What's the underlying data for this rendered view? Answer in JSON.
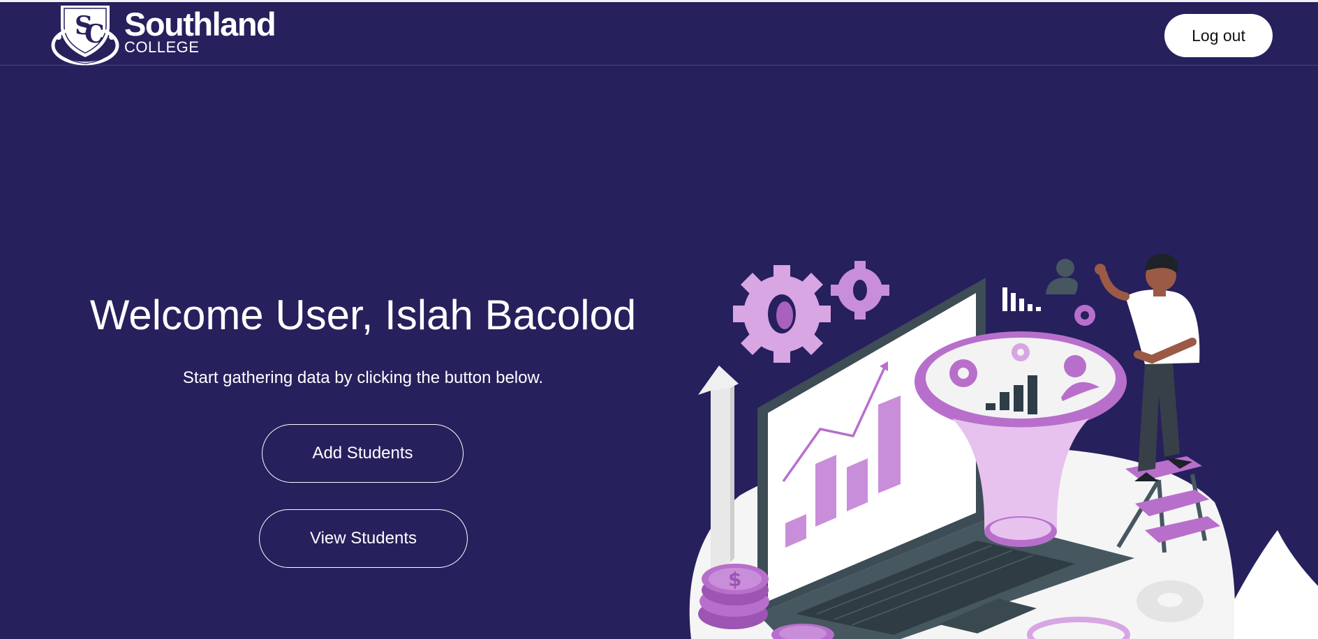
{
  "header": {
    "brand_name": "Southland",
    "brand_sub": "COLLEGE",
    "logout_label": "Log out"
  },
  "main": {
    "welcome": "Welcome User, Islah Bacolod",
    "subtitle": "Start gathering data by clicking the button below.",
    "add_students_label": "Add Students",
    "view_students_label": "View Students"
  },
  "colors": {
    "background": "#26205d",
    "accent_purple": "#b86fcc",
    "light_purple": "#e2b6ea",
    "laptop_gray": "#465760"
  },
  "icons": [
    "college-seal-logo",
    "gear-icon",
    "person-icon",
    "bar-chart-icon",
    "dollar-coin-icon"
  ]
}
